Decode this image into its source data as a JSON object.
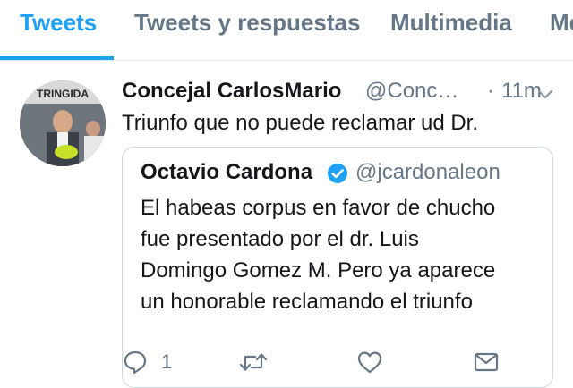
{
  "tabs": [
    {
      "label": "Tweets",
      "active": true
    },
    {
      "label": "Tweets y respuestas"
    },
    {
      "label": "Multimedia"
    },
    {
      "label": "Me"
    }
  ],
  "tweet": {
    "author_name": "Concejal CarlosMario",
    "author_handle": "@Conc…",
    "separator": "·",
    "time": "11m",
    "text": "Triunfo que no puede reclamar ud Dr.",
    "avatar_banner_text": "TRINGIDA",
    "quoted": {
      "author_name": "Octavio Cardona",
      "author_handle": "@jcardonaleon",
      "verified": true,
      "lines": [
        "El habeas corpus en favor de chucho",
        "fue presentado por el dr. Luis",
        "Domingo Gomez M. Pero ya aparece",
        "un honorable reclamando el triunfo"
      ]
    },
    "actions": {
      "reply_count": "1",
      "icons": [
        "reply-icon",
        "retweet-icon",
        "like-icon",
        "dm-icon"
      ]
    }
  },
  "colors": {
    "accent": "#1da1f2",
    "muted": "#657786",
    "text": "#14171a",
    "border": "#ccd6dd"
  }
}
